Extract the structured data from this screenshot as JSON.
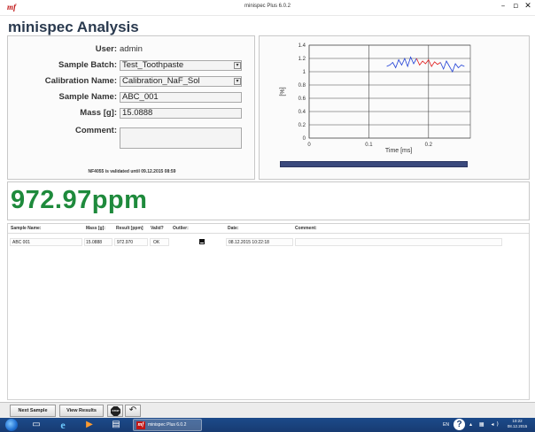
{
  "window": {
    "logo": "mf",
    "title": "minispec Plus 6.0.2",
    "controls": [
      "–",
      "▫",
      "✕"
    ]
  },
  "header": {
    "title": "minispec Analysis"
  },
  "form": {
    "user_label": "User:",
    "user_value": "admin",
    "sample_batch_label": "Sample Batch:",
    "sample_batch_value": "Test_Toothpaste",
    "calibration_label": "Calibration Name:",
    "calibration_value": "Calibration_NaF_Sol",
    "sample_name_label": "Sample Name:",
    "sample_name_value": "ABC_001",
    "mass_label": "Mass [g]:",
    "mass_value": "15.0888",
    "comment_label": "Comment:",
    "comment_value": "",
    "validation_note": "NF4055 is validated until 09.12.2015 08:59"
  },
  "chart_data": {
    "type": "line",
    "xlabel": "Time [ms]",
    "ylabel": "[%]",
    "xlim": [
      0,
      0.27
    ],
    "ylim": [
      0,
      1.4
    ],
    "x_ticks": [
      "0",
      "0.1",
      "0.2"
    ],
    "y_ticks": [
      "0",
      "0.2",
      "0.4",
      "0.6",
      "0.8",
      "1",
      "1.2",
      "1.4"
    ],
    "grid": true,
    "series": [
      {
        "color": "#1f3fd6",
        "x": [
          0.13,
          0.135,
          0.14,
          0.145,
          0.15,
          0.155,
          0.16,
          0.165,
          0.17,
          0.175,
          0.18
        ],
        "y": [
          1.08,
          1.1,
          1.14,
          1.06,
          1.18,
          1.1,
          1.2,
          1.08,
          1.22,
          1.12,
          1.2
        ]
      },
      {
        "color": "#e01818",
        "x": [
          0.18,
          0.185,
          0.19,
          0.195,
          0.2,
          0.205,
          0.21,
          0.215,
          0.22
        ],
        "y": [
          1.2,
          1.1,
          1.16,
          1.12,
          1.18,
          1.08,
          1.15,
          1.11,
          1.14
        ]
      },
      {
        "color": "#1f3fd6",
        "x": [
          0.22,
          0.225,
          0.23,
          0.235,
          0.24,
          0.245,
          0.25,
          0.255,
          0.26
        ],
        "y": [
          1.14,
          1.04,
          1.16,
          1.08,
          1.0,
          1.12,
          1.06,
          1.1,
          1.08
        ]
      }
    ]
  },
  "result": {
    "display": "972.97ppm"
  },
  "table": {
    "columns": [
      "Sample Name:",
      "Mass [g]:",
      "Result [ppm]",
      "Valid?",
      "Outlier:",
      "Date:",
      "Comment:"
    ],
    "rows": [
      {
        "sample_name": "ABC 001",
        "mass": "15.0888",
        "result": "972.970",
        "valid": "OK",
        "outlier": true,
        "date": "08.12.2015 10:22:18",
        "comment": ""
      }
    ]
  },
  "toolbar": {
    "next_sample": "Next Sample",
    "view_results": "View Results",
    "stop": "STOP",
    "undo": "↶"
  },
  "taskbar": {
    "item_label": "minispec Plus 6.0.2",
    "lang": "EN",
    "help": "?",
    "time": "10:22",
    "date": "08.12.2015"
  }
}
